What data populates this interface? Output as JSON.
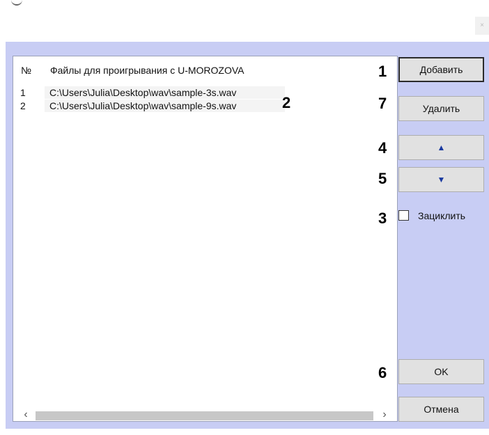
{
  "window": {
    "close_glyph": "×"
  },
  "list": {
    "header": {
      "num": "№",
      "files": "Файлы для проигрывания с U-MOROZOVA"
    },
    "rows": [
      {
        "num": "1",
        "path": "C:\\Users\\Julia\\Desktop\\wav\\sample-3s.wav"
      },
      {
        "num": "2",
        "path": "C:\\Users\\Julia\\Desktop\\wav\\sample-9s.wav"
      }
    ],
    "scroll_left_glyph": "‹",
    "scroll_right_glyph": "›"
  },
  "buttons": {
    "add": "Добавить",
    "delete": "Удалить",
    "up": "▲",
    "down": "▼",
    "ok": "OK",
    "cancel": "Отмена"
  },
  "loop": {
    "label": "Зациклить",
    "checked": false
  },
  "callouts": {
    "add": "1",
    "list": "2",
    "loop": "3",
    "up": "4",
    "down": "5",
    "ok": "6",
    "delete": "7"
  },
  "colors": {
    "dialog_bg": "#c8cdf4",
    "button_bg": "#e1e1e1",
    "arrow": "#1a3aa0"
  }
}
